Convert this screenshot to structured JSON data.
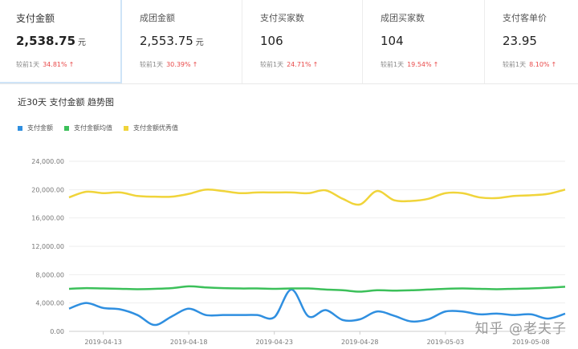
{
  "metrics": [
    {
      "label": "支付金额",
      "value": "2,538.75",
      "unit": "元",
      "cmp_label": "较前1天",
      "change": "34.81%",
      "arrow": "↑",
      "active": true
    },
    {
      "label": "成团金额",
      "value": "2,553.75",
      "unit": "元",
      "cmp_label": "较前1天",
      "change": "30.39%",
      "arrow": "↑",
      "active": false
    },
    {
      "label": "支付买家数",
      "value": "106",
      "unit": "",
      "cmp_label": "较前1天",
      "change": "24.71%",
      "arrow": "↑",
      "active": false
    },
    {
      "label": "成团买家数",
      "value": "104",
      "unit": "",
      "cmp_label": "较前1天",
      "change": "19.54%",
      "arrow": "↑",
      "active": false
    },
    {
      "label": "支付客单价",
      "value": "23.95",
      "unit": "",
      "cmp_label": "较前1天",
      "change": "8.10%",
      "arrow": "↑",
      "active": false
    }
  ],
  "watermark": "知乎 @老夫子",
  "colors": {
    "blue": "#2f8fe0",
    "green": "#3cc05a",
    "yellow": "#f0d43a",
    "up": "#e94a4a"
  },
  "chart_data": {
    "type": "line",
    "title": "近30天 支付金额 趋势图",
    "legend_position": "top-left",
    "grid": "horizontal",
    "ylim": [
      0,
      24000
    ],
    "y_ticks": [
      "0.00",
      "4,000.00",
      "8,000.00",
      "12,000.00",
      "16,000.00",
      "20,000.00",
      "24,000.00"
    ],
    "y_tick_values": [
      0,
      4000,
      8000,
      12000,
      16000,
      20000,
      24000
    ],
    "x": [
      "2019-04-11",
      "2019-04-12",
      "2019-04-13",
      "2019-04-14",
      "2019-04-15",
      "2019-04-16",
      "2019-04-17",
      "2019-04-18",
      "2019-04-19",
      "2019-04-20",
      "2019-04-21",
      "2019-04-22",
      "2019-04-23",
      "2019-04-24",
      "2019-04-25",
      "2019-04-26",
      "2019-04-27",
      "2019-04-28",
      "2019-04-29",
      "2019-04-30",
      "2019-05-01",
      "2019-05-02",
      "2019-05-03",
      "2019-05-04",
      "2019-05-05",
      "2019-05-06",
      "2019-05-07",
      "2019-05-08",
      "2019-05-09",
      "2019-05-10"
    ],
    "x_tick_labels": [
      "2019-04-13",
      "2019-04-18",
      "2019-04-23",
      "2019-04-28",
      "2019-05-03",
      "2019-05-08"
    ],
    "series": [
      {
        "name": "支付金额",
        "color": "#2f8fe0",
        "values": [
          3200,
          4000,
          3300,
          3100,
          2300,
          900,
          2100,
          3200,
          2300,
          2300,
          2300,
          2300,
          2000,
          5900,
          2100,
          3000,
          1600,
          1700,
          2800,
          2200,
          1400,
          1700,
          2800,
          2800,
          2400,
          2500,
          2300,
          2400,
          1800,
          2500
        ]
      },
      {
        "name": "支付金额均值",
        "color": "#3cc05a",
        "values": [
          6000,
          6100,
          6050,
          6000,
          5950,
          6000,
          6100,
          6350,
          6200,
          6100,
          6050,
          6050,
          6000,
          6050,
          6050,
          5900,
          5800,
          5600,
          5800,
          5750,
          5800,
          5900,
          6000,
          6050,
          6000,
          5950,
          6000,
          6050,
          6150,
          6300
        ]
      },
      {
        "name": "支付金额优秀值",
        "color": "#f0d43a",
        "values": [
          18900,
          19700,
          19500,
          19600,
          19100,
          19000,
          19000,
          19400,
          20000,
          19800,
          19500,
          19600,
          19600,
          19600,
          19500,
          19900,
          18700,
          17900,
          19800,
          18500,
          18400,
          18700,
          19500,
          19500,
          18900,
          18800,
          19100,
          19200,
          19400,
          20000
        ]
      }
    ]
  }
}
